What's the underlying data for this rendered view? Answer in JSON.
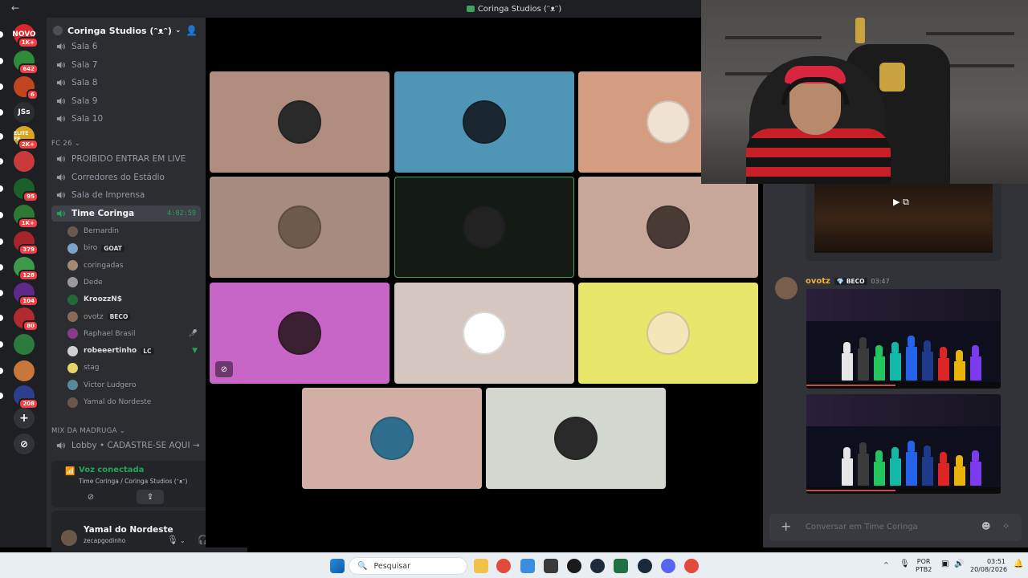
{
  "window": {
    "title": "Coringa Studios (ᵔᴥᵔ)"
  },
  "server_rail": {
    "items": [
      {
        "label": "NOVO",
        "badge": "1K+",
        "color": "#d8282f"
      },
      {
        "label": "",
        "badge": "642",
        "color": "#2f8b3a"
      },
      {
        "label": "",
        "badge": "6",
        "color": "#c2461d"
      },
      {
        "label": "JSs",
        "badge": "",
        "color": "#2b2d31"
      },
      {
        "label": "ELITE FF",
        "badge": "2K+",
        "color": "#d9a521"
      },
      {
        "label": "",
        "badge": "",
        "color": "#c93a3a"
      },
      {
        "label": "",
        "badge": "95",
        "color": "#1d5f2a"
      },
      {
        "label": "",
        "badge": "1K+",
        "color": "#2e7a35"
      },
      {
        "label": "",
        "badge": "379",
        "color": "#a8242b"
      },
      {
        "label": "",
        "badge": "128",
        "color": "#3c9a4a"
      },
      {
        "label": "",
        "badge": "104",
        "color": "#5d2a8a"
      },
      {
        "label": "",
        "badge": "80",
        "color": "#b22a30"
      },
      {
        "label": "",
        "badge": "",
        "color": "#2a7b3c"
      },
      {
        "label": "",
        "badge": "",
        "color": "#c8763a"
      },
      {
        "label": "",
        "badge": "208",
        "color": "#2c3e8c"
      }
    ],
    "add_label": "+",
    "discover_label": "⊘"
  },
  "guild": {
    "name": "Coringa Studios (ᵔᴥᵔ)"
  },
  "channels": {
    "top": [
      "Sala 6",
      "Sala 7",
      "Sala 8",
      "Sala 9",
      "Sala 10"
    ],
    "category_fc": "FC 26",
    "fc_list": [
      "PROIBIDO ENTRAR EM LIVE",
      "Corredores do Estádio",
      "Sala de Imprensa"
    ],
    "active": {
      "name": "Time Coringa",
      "timer": "4:02:59"
    },
    "members": [
      {
        "name": "Bernardin",
        "tag": "",
        "color": "#6a5a4e"
      },
      {
        "name": "biro",
        "tag": "GOAT",
        "color": "#7fa3c8"
      },
      {
        "name": "coringadas",
        "tag": "",
        "color": "#a38a70"
      },
      {
        "name": "Dede",
        "tag": "",
        "color": "#9a9a9a"
      },
      {
        "name": "KroozzN$",
        "tag": "",
        "color": "#1f6b38",
        "bold": true
      },
      {
        "name": "ovotz",
        "tag": "BECO",
        "color": "#8a6a5a"
      },
      {
        "name": "Raphael Brasil",
        "tag": "",
        "color": "#8a3a8c"
      },
      {
        "name": "robeeertinho",
        "tag": "LC",
        "color": "#d0d0d0",
        "bold": true
      },
      {
        "name": "stag",
        "tag": "",
        "color": "#e6d36a"
      },
      {
        "name": "Victor Ludgero",
        "tag": "",
        "color": "#5a8a9a"
      },
      {
        "name": "Yamal do Nordeste",
        "tag": "",
        "color": "#6b5747"
      }
    ],
    "category_mix": "MIX DA MADRUGA",
    "mix_list": [
      "Lobby • CADASTRE-SE AQUI →"
    ]
  },
  "voice": {
    "status": "Voz conectada",
    "location": "Time Coringa / Coringa Studios (ᵔᴥᵔ)"
  },
  "user": {
    "display_name": "Yamal do Nordeste",
    "handle": "zecapgodinho"
  },
  "tiles": [
    {
      "bg": "#b08d7f",
      "face": "#2a2a2a",
      "muted": false
    },
    {
      "bg": "#4f95b6",
      "face": "#1a2630",
      "muted": false
    },
    {
      "bg": "#d49d82",
      "face": "#f0e3d4",
      "muted": false
    },
    {
      "bg": "#a88b80",
      "face": "#6e5a4a",
      "muted": false
    },
    {
      "bg": "#141a14",
      "face": "#222",
      "muted": false,
      "speaking": true
    },
    {
      "bg": "#c8a79b",
      "face": "#4a3a34",
      "muted": false
    },
    {
      "bg": "#c866c8",
      "face": "#3a2030",
      "muted": true
    },
    {
      "bg": "#d5c7bf",
      "face": "#ffffff",
      "muted": false
    },
    {
      "bg": "#e8e66a",
      "face": "#f4e6b8",
      "muted": false
    },
    {
      "bg": "#d2aea4",
      "face": "#2e6e8c",
      "muted": false
    },
    {
      "bg": "#d2d8d0",
      "face": "#2a2a2a",
      "muted": false
    }
  ],
  "chat": {
    "message": {
      "author": "ovotz",
      "tag": "BECO",
      "time": "03:47"
    },
    "composer_placeholder": "Conversar em Time Coringa"
  },
  "taskbar": {
    "search_placeholder": "Pesquisar",
    "lang_top": "POR",
    "lang_bottom": "PTB2",
    "time": "03:51",
    "date": "20/08/2026"
  }
}
